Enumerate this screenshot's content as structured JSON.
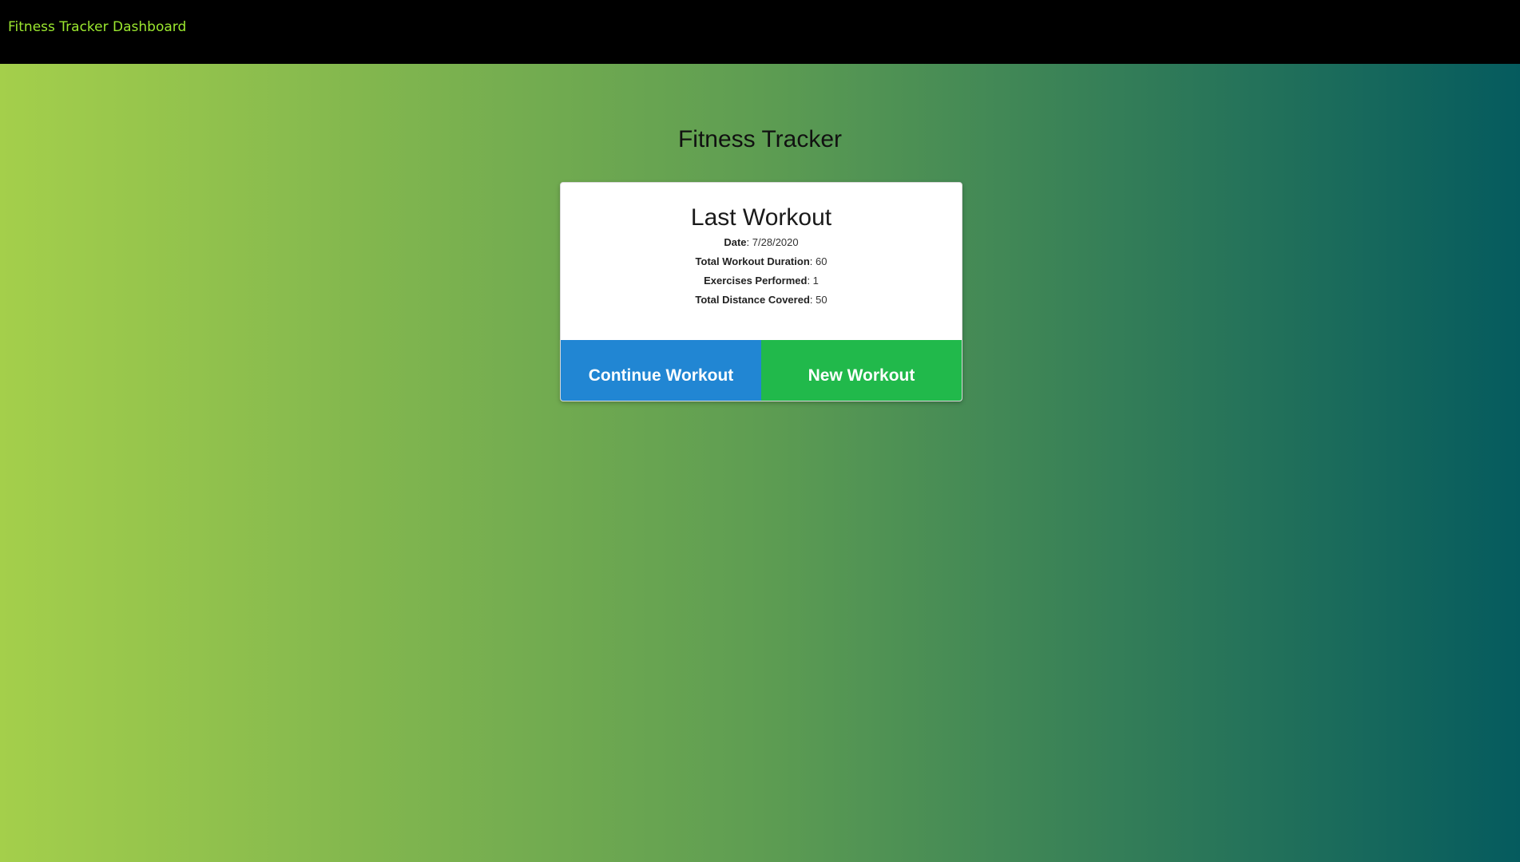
{
  "navbar": {
    "brand": "Fitness Tracker Dashboard"
  },
  "page": {
    "title": "Fitness Tracker"
  },
  "last_workout": {
    "title": "Last Workout",
    "stats": [
      {
        "label": "Date",
        "value": "7/28/2020"
      },
      {
        "label": "Total Workout Duration",
        "value": "60"
      },
      {
        "label": "Exercises Performed",
        "value": "1"
      },
      {
        "label": "Total Distance Covered",
        "value": "50"
      }
    ],
    "continue_label": "Continue Workout",
    "new_label": "New Workout"
  },
  "colors": {
    "navbar_bg": "#000000",
    "brand_text": "#9be82f",
    "continue_button": "#2186d3",
    "new_button": "#21b94b",
    "gradient_start": "#a4cf4b",
    "gradient_end": "#055b5e"
  }
}
